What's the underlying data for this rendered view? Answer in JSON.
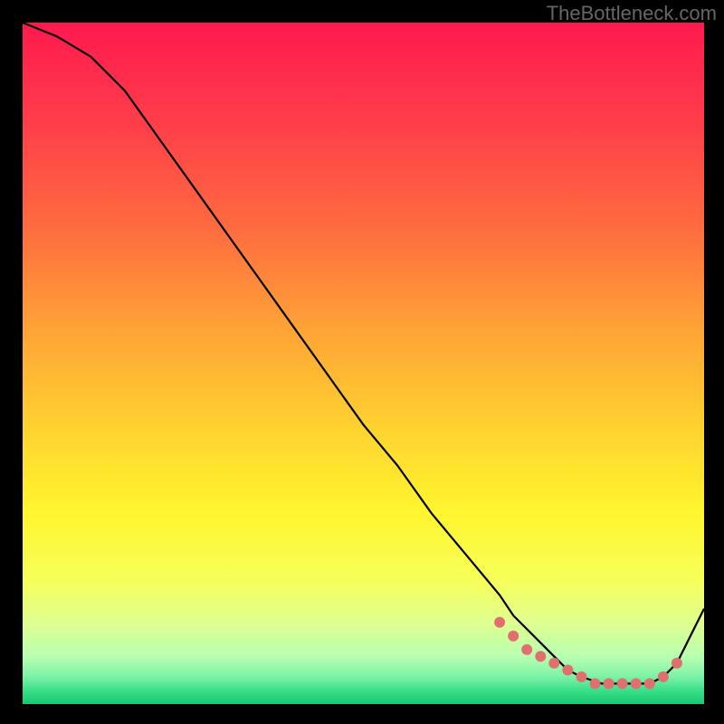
{
  "watermark": "TheBottleneck.com",
  "chart_data": {
    "type": "line",
    "title": "",
    "xlabel": "",
    "ylabel": "",
    "xlim": [
      0,
      100
    ],
    "ylim": [
      0,
      100
    ],
    "x": [
      0,
      5,
      10,
      15,
      20,
      25,
      30,
      35,
      40,
      45,
      50,
      55,
      60,
      65,
      70,
      72,
      75,
      78,
      80,
      82,
      85,
      88,
      90,
      92,
      94,
      96,
      98,
      100
    ],
    "y": [
      100,
      98,
      95,
      90,
      83,
      76,
      69,
      62,
      55,
      48,
      41,
      35,
      28,
      22,
      16,
      13,
      10,
      7,
      5,
      4,
      3,
      3,
      3,
      3,
      4,
      6,
      10,
      14
    ],
    "markers_x": [
      70,
      72,
      74,
      76,
      78,
      80,
      82,
      84,
      86,
      88,
      90,
      92,
      94,
      96
    ],
    "markers_y": [
      12,
      10,
      8,
      7,
      6,
      5,
      4,
      3,
      3,
      3,
      3,
      3,
      4,
      6
    ],
    "marker_color": "#e0706e",
    "gradient_stops": [
      {
        "offset": 0.0,
        "color": "#ff1a4e"
      },
      {
        "offset": 0.15,
        "color": "#ff3e4a"
      },
      {
        "offset": 0.3,
        "color": "#ff6b3f"
      },
      {
        "offset": 0.45,
        "color": "#ffa336"
      },
      {
        "offset": 0.6,
        "color": "#ffd42f"
      },
      {
        "offset": 0.72,
        "color": "#fff62e"
      },
      {
        "offset": 0.82,
        "color": "#f6ff5a"
      },
      {
        "offset": 0.88,
        "color": "#e0ff90"
      },
      {
        "offset": 0.93,
        "color": "#b8ffb0"
      },
      {
        "offset": 0.96,
        "color": "#7cf2a6"
      },
      {
        "offset": 0.98,
        "color": "#39df8a"
      },
      {
        "offset": 1.0,
        "color": "#17c96f"
      }
    ]
  }
}
